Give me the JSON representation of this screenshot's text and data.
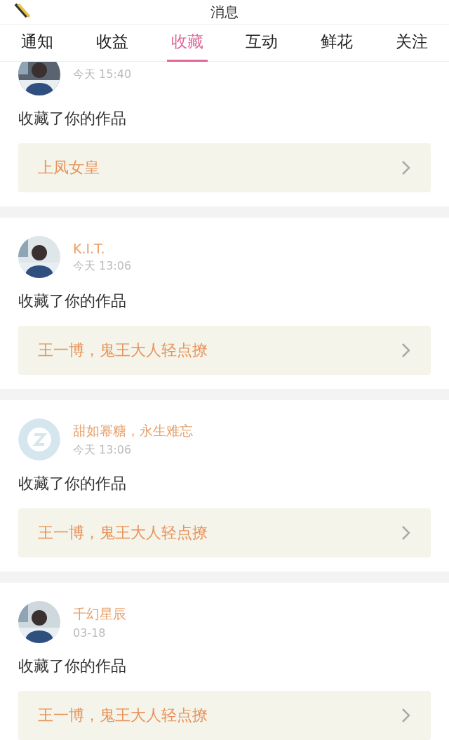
{
  "header": {
    "title": "消息"
  },
  "tabs": [
    {
      "label": "通知",
      "selected": false
    },
    {
      "label": "收益",
      "selected": false
    },
    {
      "label": "收藏",
      "selected": true
    },
    {
      "label": "互动",
      "selected": false
    },
    {
      "label": "鲜花",
      "selected": false
    },
    {
      "label": "关注",
      "selected": false
    }
  ],
  "messages": [
    {
      "time": "今天 15:40",
      "action": "收藏了你的作品",
      "work": "上凤女皇"
    },
    {
      "name": "K.I.T.",
      "time": "今天 13:06",
      "action": "收藏了你的作品",
      "work": "王一博，鬼王大人轻点撩"
    },
    {
      "avatar": {
        "kind": "default"
      },
      "name": "甜如幂糖，永生难忘",
      "time": "今天 13:06",
      "action": "收藏了你的作品",
      "work": "王一博，鬼王大人轻点撩"
    },
    {
      "name": "千幻星辰",
      "time": "03-18",
      "action": "收藏了你的作品",
      "work": "王一博，鬼王大人轻点撩"
    }
  ]
}
